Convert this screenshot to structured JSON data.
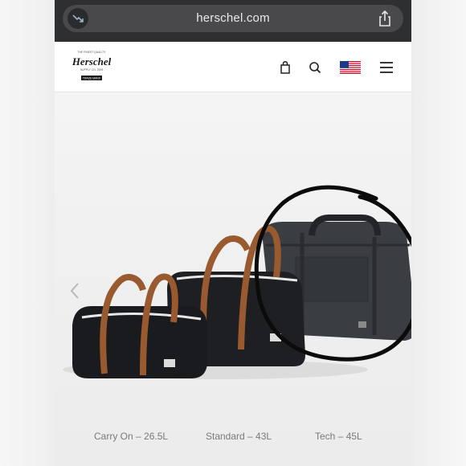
{
  "browser": {
    "url": "herschel.com",
    "trend_icon": "trending-down-icon",
    "share_icon": "share-icon"
  },
  "header": {
    "logo": {
      "top_text": "THE FINEST QUALITY",
      "brand": "Herschel",
      "supply": "SUPPLY CO. 2009",
      "ribbon": "TRADE MARK"
    },
    "icons": [
      "bag-icon",
      "search-icon",
      "us-flag-icon",
      "menu-icon"
    ]
  },
  "products": [
    {
      "label": "Carry On – 26.5L"
    },
    {
      "label": "Standard – 43L"
    },
    {
      "label": "Tech – 45L"
    }
  ],
  "colors": {
    "url_bar": "#2e2f31",
    "bag_black": "#1c1d20",
    "strap_brown": "#9a5a30",
    "tech_gray": "#3a3d42"
  }
}
